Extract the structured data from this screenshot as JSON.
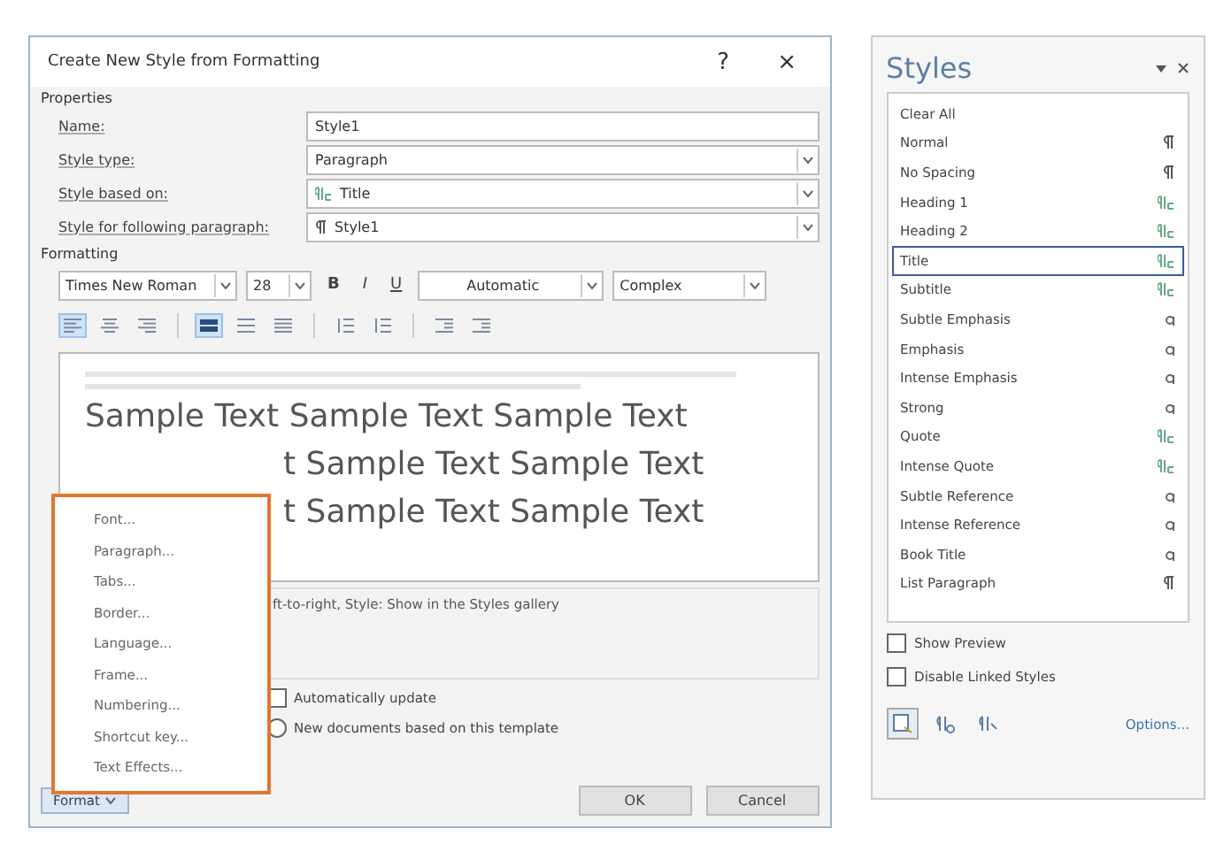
{
  "dialog": {
    "title": "Create New Style from Formatting",
    "help": "?",
    "close": "×"
  },
  "properties": {
    "label": "Properties",
    "fields": [
      {
        "label": "Name:",
        "kind": "text",
        "value": "Style1"
      },
      {
        "label": "Style type:",
        "kind": "select",
        "value": "Paragraph"
      },
      {
        "label": "Style based on:",
        "kind": "linked-select",
        "value": "Title"
      },
      {
        "label": "Style for following paragraph:",
        "kind": "paragraph-select",
        "value": "Style1"
      }
    ]
  },
  "formatting": {
    "label": "Formatting",
    "font": "Times New Roman",
    "size": "28",
    "bold": "B",
    "italic": "I",
    "underline": "U",
    "font_color": "Automatic",
    "script": "Complex",
    "tools": [
      {
        "kind": "align-left",
        "selected": true
      },
      {
        "kind": "align-center",
        "selected": false
      },
      {
        "kind": "align-right",
        "selected": false
      },
      {
        "kind": "justify-thick",
        "selected": true
      },
      {
        "kind": "justify-medium",
        "selected": false
      },
      {
        "kind": "justify-thin",
        "selected": false
      },
      {
        "kind": "spacing-increase",
        "selected": false
      },
      {
        "kind": "spacing-decrease",
        "selected": false
      },
      {
        "kind": "indent-decrease",
        "selected": false
      },
      {
        "kind": "indent-increase",
        "selected": false
      }
    ]
  },
  "preview": {
    "lines": [
      "Sample Text Sample Text Sample Text",
      "t Sample Text Sample Text",
      "t Sample Text Sample Text"
    ]
  },
  "description": "ft-to-right, Style: Show in the Styles gallery",
  "options": [
    {
      "kind": "checkbox",
      "label": "Automatically update",
      "checked": false
    },
    {
      "kind": "radio",
      "label": "New documents based on this template",
      "checked": false
    }
  ],
  "format_button": "Format",
  "format_menu": [
    "Font...",
    "Paragraph...",
    "Tabs...",
    "Border...",
    "Language...",
    "Frame...",
    "Numbering...",
    "Shortcut key...",
    "Text Effects..."
  ],
  "buttons": [
    "OK",
    "Cancel"
  ],
  "styles_pane": {
    "title": "Styles",
    "items": [
      {
        "name": "Clear All",
        "kind": "none",
        "selected": false
      },
      {
        "name": "Normal",
        "kind": "paragraph",
        "selected": false
      },
      {
        "name": "No Spacing",
        "kind": "paragraph",
        "selected": false
      },
      {
        "name": "Heading 1",
        "kind": "linked",
        "selected": false
      },
      {
        "name": "Heading 2",
        "kind": "linked",
        "selected": false
      },
      {
        "name": "Title",
        "kind": "linked",
        "selected": true
      },
      {
        "name": "Subtitle",
        "kind": "linked",
        "selected": false
      },
      {
        "name": "Subtle Emphasis",
        "kind": "character",
        "selected": false
      },
      {
        "name": "Emphasis",
        "kind": "character",
        "selected": false
      },
      {
        "name": "Intense Emphasis",
        "kind": "character",
        "selected": false
      },
      {
        "name": "Strong",
        "kind": "character",
        "selected": false
      },
      {
        "name": "Quote",
        "kind": "linked",
        "selected": false
      },
      {
        "name": "Intense Quote",
        "kind": "linked",
        "selected": false
      },
      {
        "name": "Subtle Reference",
        "kind": "character",
        "selected": false
      },
      {
        "name": "Intense Reference",
        "kind": "character",
        "selected": false
      },
      {
        "name": "Book Title",
        "kind": "character",
        "selected": false
      },
      {
        "name": "List Paragraph",
        "kind": "paragraph",
        "selected": false
      }
    ],
    "checks": [
      {
        "label": "Show Preview",
        "checked": false
      },
      {
        "label": "Disable Linked Styles",
        "checked": false
      }
    ],
    "options_link": "Options..."
  }
}
